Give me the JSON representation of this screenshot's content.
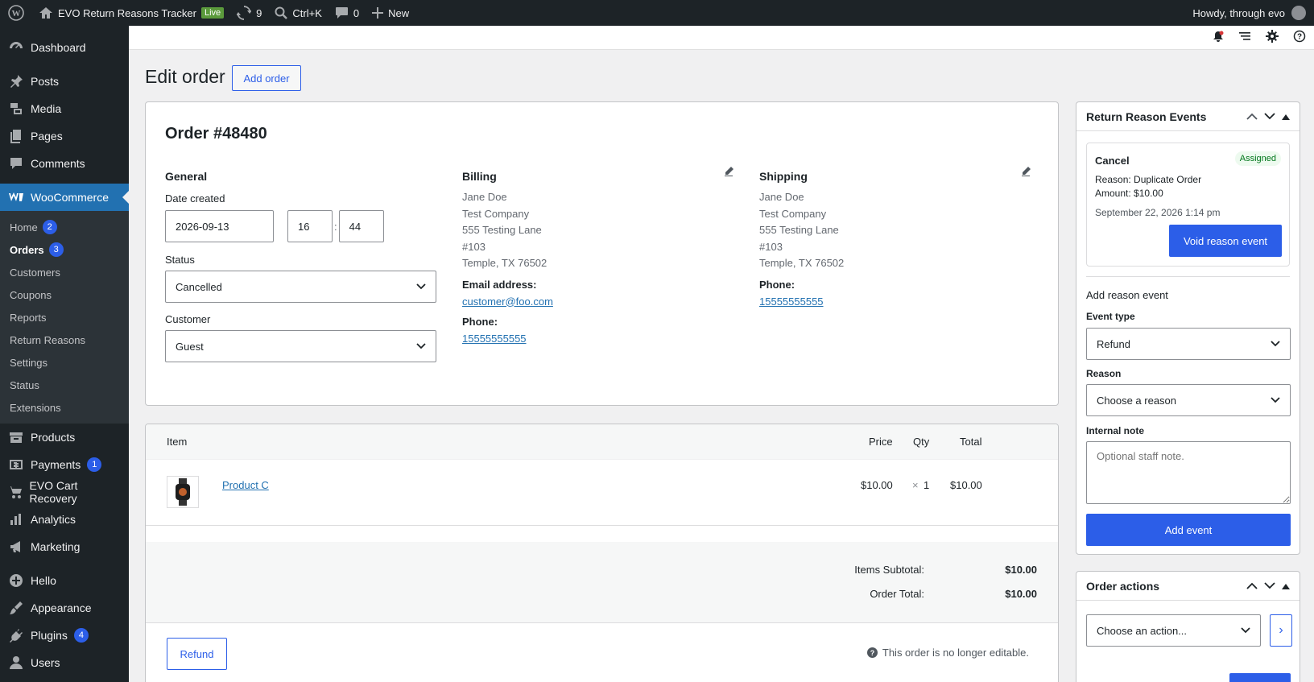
{
  "admin_bar": {
    "site_name": "EVO Return Reasons Tracker",
    "live_label": "Live",
    "updates_count": "9",
    "search_shortcut": "Ctrl+K",
    "comments_count": "0",
    "new_label": "New",
    "howdy": "Howdy, through evo"
  },
  "sidebar": {
    "items": [
      {
        "label": "Dashboard",
        "icon": "dashboard-icon"
      },
      {
        "label": "Posts",
        "icon": "pin-icon"
      },
      {
        "label": "Media",
        "icon": "media-icon"
      },
      {
        "label": "Pages",
        "icon": "pages-icon"
      },
      {
        "label": "Comments",
        "icon": "comment-icon"
      },
      {
        "label": "WooCommerce",
        "icon": "woo-icon"
      }
    ],
    "woo_submenu": [
      {
        "label": "Home",
        "badge": "2"
      },
      {
        "label": "Orders",
        "badge": "3"
      },
      {
        "label": "Customers"
      },
      {
        "label": "Coupons"
      },
      {
        "label": "Reports"
      },
      {
        "label": "Return Reasons"
      },
      {
        "label": "Settings"
      },
      {
        "label": "Status"
      },
      {
        "label": "Extensions"
      }
    ],
    "items2": [
      {
        "label": "Products",
        "icon": "products-icon"
      },
      {
        "label": "Payments",
        "icon": "payments-icon",
        "badge": "1"
      },
      {
        "label": "EVO Cart Recovery",
        "icon": "cart-icon"
      },
      {
        "label": "Analytics",
        "icon": "analytics-icon"
      },
      {
        "label": "Marketing",
        "icon": "megaphone-icon"
      },
      {
        "label": "Hello",
        "icon": "plus-circle-icon"
      },
      {
        "label": "Appearance",
        "icon": "brush-icon"
      },
      {
        "label": "Plugins",
        "icon": "plug-icon",
        "badge": "4"
      },
      {
        "label": "Users",
        "icon": "user-icon"
      }
    ]
  },
  "page": {
    "title": "Edit order",
    "add_order": "Add order"
  },
  "order": {
    "heading": "Order #48480",
    "general_title": "General",
    "date_label": "Date created",
    "date": "2026-09-13",
    "hour": "16",
    "minute": "44",
    "time_sep": ":",
    "status_label": "Status",
    "status": "Cancelled",
    "customer_label": "Customer",
    "customer": "Guest",
    "billing_title": "Billing",
    "billing_lines": [
      "Jane Doe",
      "Test Company",
      "555 Testing Lane",
      "#103",
      "Temple, TX 76502"
    ],
    "email_label": "Email address:",
    "email": "customer@foo.com",
    "billing_phone_label": "Phone:",
    "billing_phone": "15555555555",
    "shipping_title": "Shipping",
    "shipping_lines": [
      "Jane Doe",
      "Test Company",
      "555 Testing Lane",
      "#103",
      "Temple, TX 76502"
    ],
    "shipping_phone_label": "Phone:",
    "shipping_phone": "15555555555"
  },
  "items": {
    "col_item": "Item",
    "col_price": "Price",
    "col_qty": "Qty",
    "col_total": "Total",
    "row": {
      "name": "Product C",
      "price": "$10.00",
      "qty_x": "×",
      "qty": "1",
      "total": "$10.00"
    },
    "subtotal_label": "Items Subtotal:",
    "subtotal": "$10.00",
    "total_label": "Order Total:",
    "total": "$10.00",
    "refund": "Refund",
    "not_editable": "This order is no longer editable."
  },
  "return_events": {
    "title": "Return Reason Events",
    "event_type": "Cancel",
    "status": "Assigned",
    "reason_label": "Reason:",
    "reason": "Duplicate Order",
    "amount_label": "Amount:",
    "amount": "$10.00",
    "date": "September 22, 2026 1:14 pm",
    "void_button": "Void reason event",
    "add_title": "Add reason event",
    "event_type_label": "Event type",
    "event_type_value": "Refund",
    "reason_field_label": "Reason",
    "reason_placeholder": "Choose a reason",
    "note_label": "Internal note",
    "note_placeholder": "Optional staff note.",
    "add_button": "Add event"
  },
  "order_actions": {
    "title": "Order actions",
    "select": "Choose an action...",
    "go": "›"
  },
  "colors": {
    "accent": "#2c5ee8",
    "menu_current": "#2271b1",
    "dark": "#1d2327"
  }
}
